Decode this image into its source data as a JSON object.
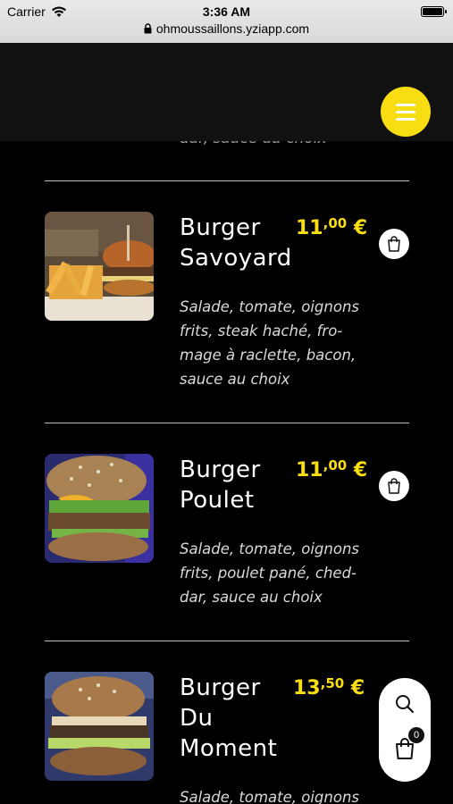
{
  "status_bar": {
    "carrier": "Carrier",
    "time": "3:36 AM",
    "url": "ohmoussaillons.yziapp.com"
  },
  "header": {
    "menu_icon": "hamburger-menu-icon",
    "accent_color": "#f9dd13"
  },
  "partial_text": "dar, sauce au choix",
  "products": [
    {
      "name_line1": "Burger",
      "name_line2": "Savoyard",
      "name_line3": "",
      "price_int": "11",
      "price_dec": ",00",
      "currency": "€",
      "description": "Salade, tomate, oignons frits, steak haché, fro-mage à raclette, bacon, sauce au choix"
    },
    {
      "name_line1": "Burger",
      "name_line2": "Poulet",
      "name_line3": "",
      "price_int": "11",
      "price_dec": ",00",
      "currency": "€",
      "description": "Salade, tomate, oignons frits, poulet pané, ched-dar, sauce au choix"
    },
    {
      "name_line1": "Burger",
      "name_line2": "Du",
      "name_line3": "Moment",
      "price_int": "13",
      "price_dec": ",50",
      "currency": "€",
      "description": "Salade, tomate, oignons"
    }
  ],
  "fab": {
    "search_icon": "search-icon",
    "cart_icon": "cart-icon",
    "cart_count": "0"
  }
}
